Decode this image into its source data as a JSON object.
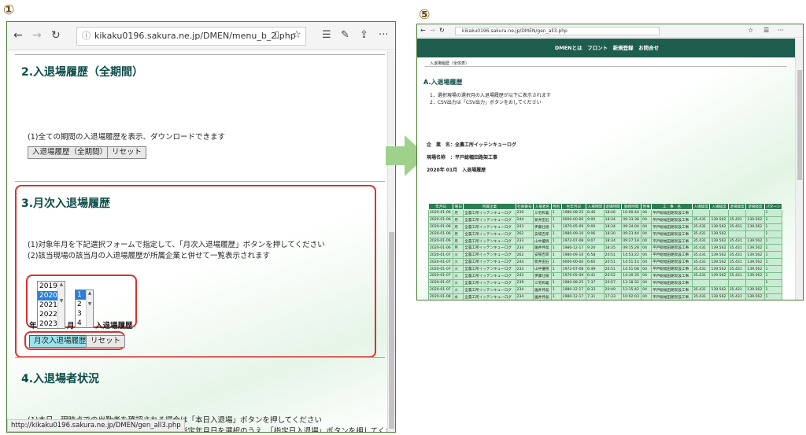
{
  "markers": {
    "m1": "①",
    "m2": "②",
    "m3": "③",
    "m4": "④",
    "m5": "⑤"
  },
  "left": {
    "url": "kikaku0196.sakura.ne.jp/DMEN/menu_b_2.php",
    "section2": {
      "title": "2.入退場履歴（全期間）",
      "desc": "(1)全ての期間の入退場履歴を表示、ダウンロードできます",
      "button": "入退場履歴（全期間）",
      "reset": "リセット"
    },
    "section3": {
      "title": "3.月次入退場履歴",
      "desc1": "(1)対象年月を下記選択フォームで指定して、「月次入退場履歴」ボタンを押してください",
      "desc2": "(2)該当現場の該当月の入退場履歴が所属企業と併せて一覧表示されます",
      "years": [
        "2019",
        "2020",
        "2021",
        "2022",
        "2023"
      ],
      "selected_year": "2020",
      "months": [
        "1",
        "2",
        "3",
        "4"
      ],
      "selected_month": "1",
      "year_label": "年",
      "month_label": "月",
      "after_label": "入退場履歴",
      "button": "月次入退場履歴",
      "reset": "リセット"
    },
    "section4": {
      "title": "4.入退場者状況",
      "desc1": "(1)本日、現時点での出勤者を確認される場合は「本日入退場」ボタンを押してください",
      "desc2": "(2)指定日における入退場を確認される場合は指定年月日を選択のうえ、「指定日入退場」ボタンを押してください"
    },
    "status_url": "http://kikaku0196.sakura.ne.jp/DMEN/gen_all3.php"
  },
  "right": {
    "url": "kikaku0196.sakura.ne.jp/DMEN/gen_all3.php",
    "nav": "DMENとは　フロント　新規登録　お問合せ",
    "breadcrumb": "入退場履歴（全体表）",
    "title": "A.入退場履歴",
    "note1": "1．選択現場の選択月の入退場履歴が以下に表示されます",
    "note2": "2．CSV出力は「CSV出力」ボタンをおしてください",
    "company": "企　業　名：全農工所イッテンキューログ",
    "site": "現場名称　：平戸総幅田路架工事",
    "period": "2020年 01月　入退場履歴",
    "headers": [
      "年月日",
      "曜日",
      "所属企業",
      "社員番号",
      "入場者名",
      "性別",
      "生年月日",
      "入場時間",
      "退場時間",
      "勤務時間",
      "性事",
      "工　事　名",
      "入場緯度",
      "入場経度",
      "退場緯度",
      "退場経度",
      "パターン"
    ],
    "rows": [
      [
        "2020-01-06",
        "月",
        "全農工所イッテンキューログ",
        "239",
        "三宅和義",
        "1",
        "1980-08-25",
        "8:46",
        "18:46",
        "10:00:44",
        "04",
        "平戸総幅田路架設工事",
        "",
        "",
        "",
        "",
        "1"
      ],
      [
        "2020-01-06",
        "月",
        "全農工所イッテンキューログ",
        "244",
        "新井田石",
        "1",
        "0000-00-00",
        "9:00",
        "18:34",
        "09:33:38",
        "04",
        "平戸総幅田路架設工事",
        "35.431",
        "139.562",
        "35.431",
        "139.562",
        "1"
      ],
      [
        "2020-01-06",
        "月",
        "全農工所イッテンキューログ",
        "243",
        "伊藤壮樹",
        "1",
        "1970-05-09",
        "9:00",
        "18:34",
        "09:34:04",
        "04",
        "平戸総幅田路架設工事",
        "35.431",
        "139.562",
        "35.431",
        "139.562",
        "1"
      ],
      [
        "2020-01-06",
        "月",
        "全農工所イッテンキューログ",
        "262",
        "安場吉郎",
        "1",
        "1980-09-10",
        "9:06",
        "18:30",
        "09:23:44",
        "04",
        "平戸総幅田路架設工事",
        "35.431",
        "139.562",
        "",
        "",
        "1"
      ],
      [
        "2020-01-06",
        "月",
        "全農工所イッテンキューログ",
        "233",
        "山中優暁",
        "1",
        "1972-07-08",
        "9:07",
        "18:34",
        "09:27:18",
        "04",
        "平戸総幅田路架設工事",
        "35.431",
        "139.562",
        "35.431",
        "139.562",
        "1"
      ],
      [
        "2020-01-06",
        "月",
        "全農工所イッテンキューログ",
        "234",
        "園井伸晶",
        "1",
        "1980-12-17",
        "9:20",
        "18:35",
        "09:15:28",
        "04",
        "平戸総幅田路架設工事",
        "35.431",
        "139.562",
        "35.431",
        "139.562",
        "1"
      ],
      [
        "2020-01-07",
        "火",
        "全農工所イッテンキューログ",
        "262",
        "安場吉郎",
        "1",
        "1980-09-10",
        "6:58",
        "20:51",
        "14:53:22",
        "04",
        "平戸総幅田路架設工事",
        "35.431",
        "139.562",
        "35.431",
        "139.562",
        "1"
      ],
      [
        "2020-01-07",
        "火",
        "全農工所イッテンキューログ",
        "244",
        "新井田石",
        "1",
        "0000-00-00",
        "6:60",
        "20:51",
        "14:51:14",
        "04",
        "平戸総幅田路架設工事",
        "35.431",
        "139.562",
        "35.431",
        "139.562",
        "1"
      ],
      [
        "2020-01-07",
        "火",
        "全農工所イッテンキューログ",
        "233",
        "山中優暁",
        "1",
        "1972-07-08",
        "6:49",
        "20:51",
        "14:51:08",
        "04",
        "平戸総幅田路架設工事",
        "35.431",
        "139.562",
        "35.431",
        "139.562",
        "1"
      ],
      [
        "2020-01-07",
        "火",
        "全農工所イッテンキューログ",
        "243",
        "伊藤壮樹",
        "1",
        "1970-05-09",
        "6:41",
        "20:52",
        "14:10:35",
        "04",
        "平戸総幅田路架設工事",
        "35.431",
        "139.562",
        "35.431",
        "139.562",
        "1"
      ],
      [
        "2020-01-07",
        "火",
        "全農工所イッテンキューログ",
        "239",
        "三宅和義",
        "1",
        "1980-08-25",
        "7:37",
        "20:57",
        "13:18:32",
        "04",
        "平戸総幅田路架設工事",
        "",
        "",
        "",
        "",
        "1"
      ],
      [
        "2020-01-07",
        "火",
        "全農工所イッテンキューログ",
        "234",
        "園井伸晶",
        "1",
        "1980-12-17",
        "8:33",
        "20:49",
        "12:15:42",
        "04",
        "平戸総幅田路架設工事",
        "35.431",
        "139.562",
        "35.431",
        "139.562",
        "1"
      ],
      [
        "2020-01-08",
        "水",
        "全農工所イッテンキューログ",
        "234",
        "園井伸晶",
        "1",
        "1980-12-17",
        "7:31",
        "17:33",
        "10:02:03",
        "04",
        "平戸総幅田路架設工事",
        "35.431",
        "139.562",
        "35.431",
        "139.562",
        "1"
      ],
      [
        "2020-01-08",
        "水",
        "全農工所イッテンキューログ",
        "262",
        "安場吉郎",
        "1",
        "1980-09-10",
        "7:32",
        "17:28",
        "09:56:17",
        "04",
        "平戸総幅田路架設工事",
        "35.431",
        "139.562",
        "35.431",
        "139.562",
        "1"
      ],
      [
        "2020-01-08",
        "水",
        "全農工所イッテンキューログ",
        "233",
        "山中優暁",
        "1",
        "1972-07-08",
        "7:32",
        "17:29",
        "09:56:43",
        "04",
        "平戸総幅田路架設工事",
        "35.431",
        "139.562",
        "35.432",
        "139.562",
        "0"
      ],
      [
        "2020-01-08",
        "水",
        "全農工所イッテンキューログ",
        "243",
        "伊藤壮樹",
        "1",
        "1970-05-09",
        "7:32",
        "17:29",
        "09:56:28",
        "04",
        "平戸総幅田路架設工事",
        "35.431",
        "139.562",
        "35.431",
        "139.562",
        "1"
      ]
    ]
  },
  "colors": {
    "accent": "#0b4b47",
    "banner": "#1f5d4e",
    "table_header": "#2f7d52",
    "table_cell": "#c9ecd2",
    "highlight": "#d9312e",
    "selected_button": "#9be3ec"
  }
}
